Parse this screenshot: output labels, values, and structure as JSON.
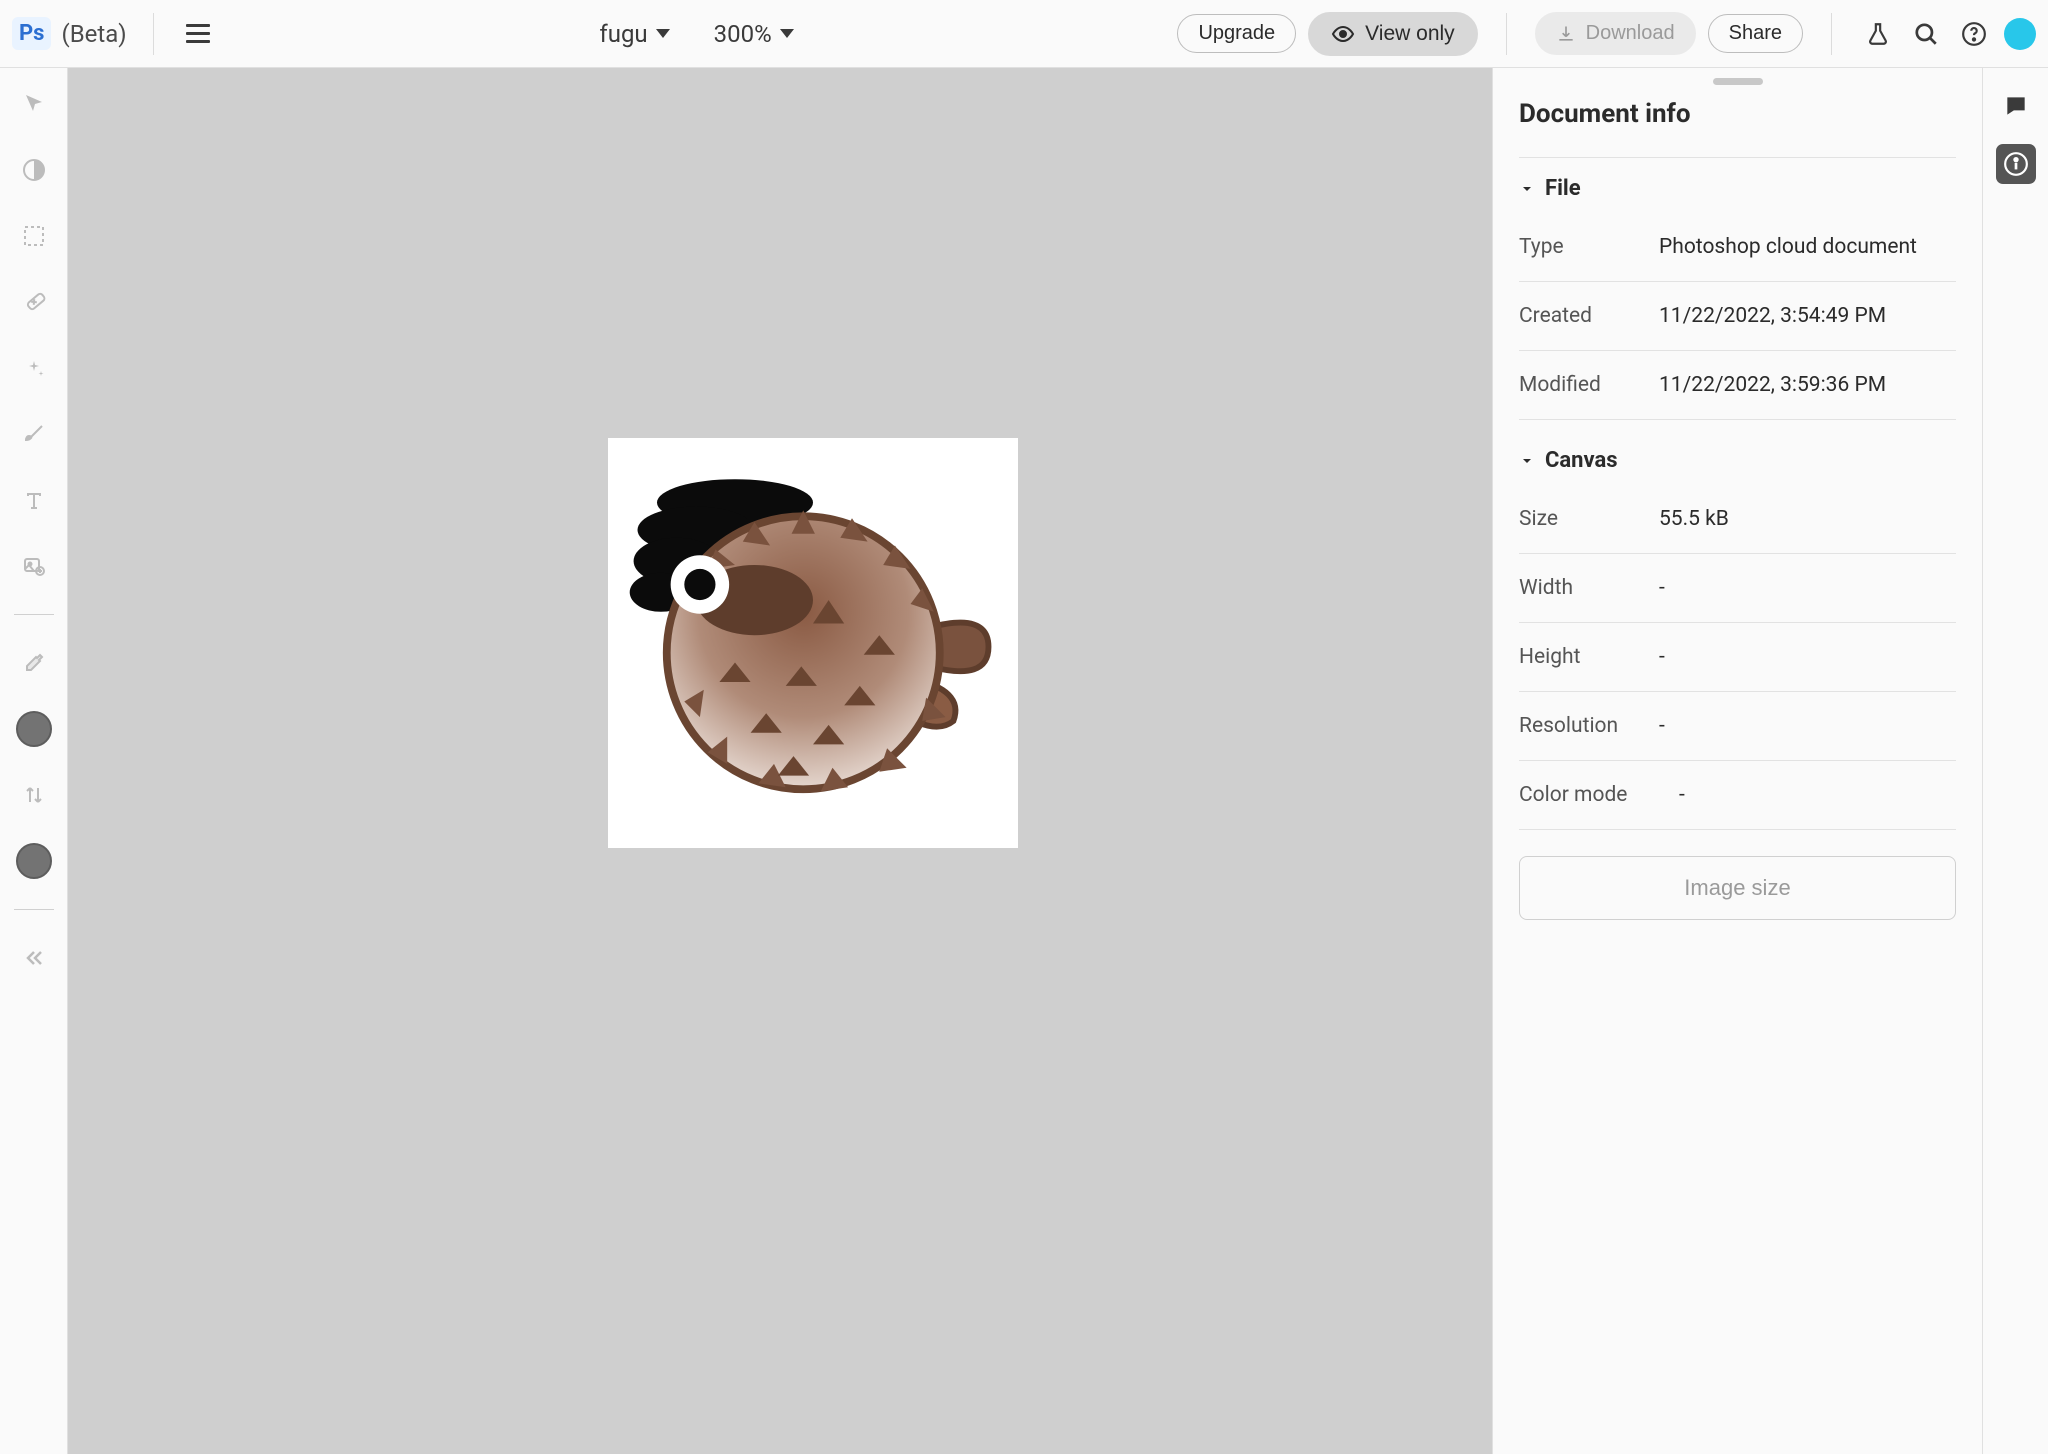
{
  "header": {
    "app_badge": "Ps",
    "beta_label": "(Beta)",
    "doc_name": "fugu",
    "zoom": "300%",
    "upgrade_label": "Upgrade",
    "view_only_label": "View only",
    "download_label": "Download",
    "share_label": "Share"
  },
  "panel": {
    "title": "Document info",
    "sections": {
      "file": {
        "title": "File",
        "rows": {
          "type": {
            "label": "Type",
            "value": "Photoshop cloud document"
          },
          "created": {
            "label": "Created",
            "value": "11/22/2022, 3:54:49 PM"
          },
          "modified": {
            "label": "Modified",
            "value": "11/22/2022, 3:59:36 PM"
          }
        }
      },
      "canvas": {
        "title": "Canvas",
        "rows": {
          "size": {
            "label": "Size",
            "value": "55.5 kB"
          },
          "width": {
            "label": "Width",
            "value": "-"
          },
          "height": {
            "label": "Height",
            "value": "-"
          },
          "resolution": {
            "label": "Resolution",
            "value": "-"
          },
          "color_mode": {
            "label": "Color mode",
            "value": "-"
          }
        }
      }
    },
    "image_size_label": "Image size"
  }
}
